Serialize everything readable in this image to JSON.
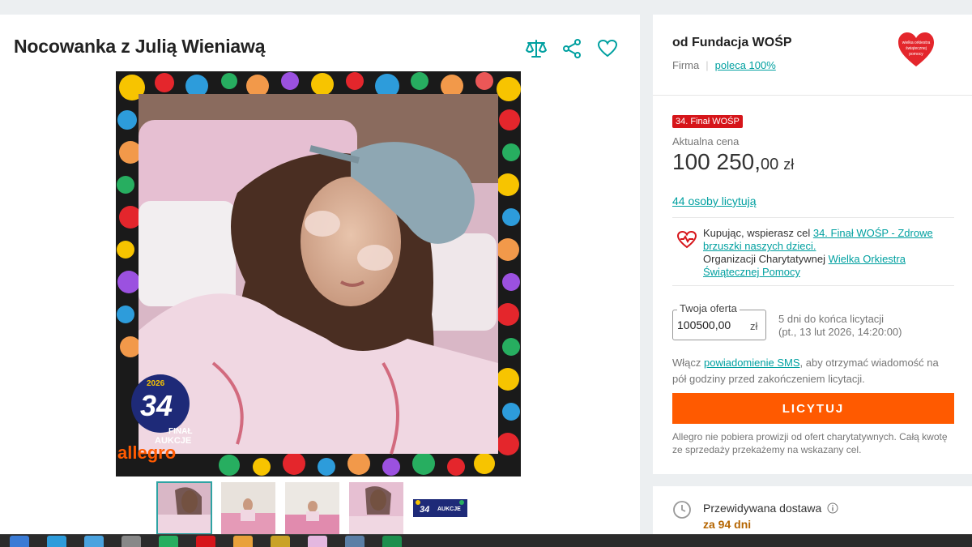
{
  "product": {
    "title": "Nocowanka z Julią Wieniawą"
  },
  "actions": [
    {
      "name": "compare",
      "label": "Porównaj"
    },
    {
      "name": "share",
      "label": "Udostępnij"
    },
    {
      "name": "favorite",
      "label": "Obserwuj"
    }
  ],
  "gallery": {
    "active_index": 0,
    "thumbnail_count": 5,
    "overlay": {
      "edition": "34",
      "final_label": "FINAŁ",
      "auction_label": "AUKCJE",
      "brand": "allegro",
      "year": "2026"
    }
  },
  "seller": {
    "name": "od Fundacja WOŚP",
    "type": "Firma",
    "recommend": "poleca 100%",
    "logo_text": [
      "wielka orkiestra",
      "świątecznej",
      "pomocy"
    ]
  },
  "auction": {
    "badge": "34. Finał WOŚP",
    "price_label": "Aktualna cena",
    "price_main": "100 250,",
    "price_decimal": "00",
    "currency": "zł",
    "bidders": "44 osoby licytują"
  },
  "support": {
    "prefix": "Kupując, wspierasz cel ",
    "goal_link": "34. Finał WOŚP - Zdrowe brzuszki naszych dzieci.",
    "org_prefix": "Organizacji Charytatywnej ",
    "org_link": "Wielka Orkiestra Świątecznej Pomocy"
  },
  "offer": {
    "legend": "Twoja oferta",
    "value": "100500,00",
    "unit": "zł",
    "time_left": "5 dni do końca licytacji",
    "end_date": "(pt., 13 lut 2026, 14:20:00)"
  },
  "sms": {
    "prefix": "Włącz ",
    "link": "powiadomienie SMS",
    "suffix": ", aby otrzymać wiadomość na pół godziny przed zakończeniem licytacji."
  },
  "bid_button": "LICYTUJ",
  "disclaimer": "Allegro nie pobiera prowizji od ofert charytatywnych. Całą kwotę ze sprzedaży przekażemy na wskazany cel.",
  "delivery": {
    "label": "Przewidywana dostawa",
    "value": "za 94 dni"
  },
  "colors": {
    "accent": "#00a0a0",
    "button": "#ff5a00",
    "badge": "#d6151a",
    "delivery": "#b56500"
  }
}
